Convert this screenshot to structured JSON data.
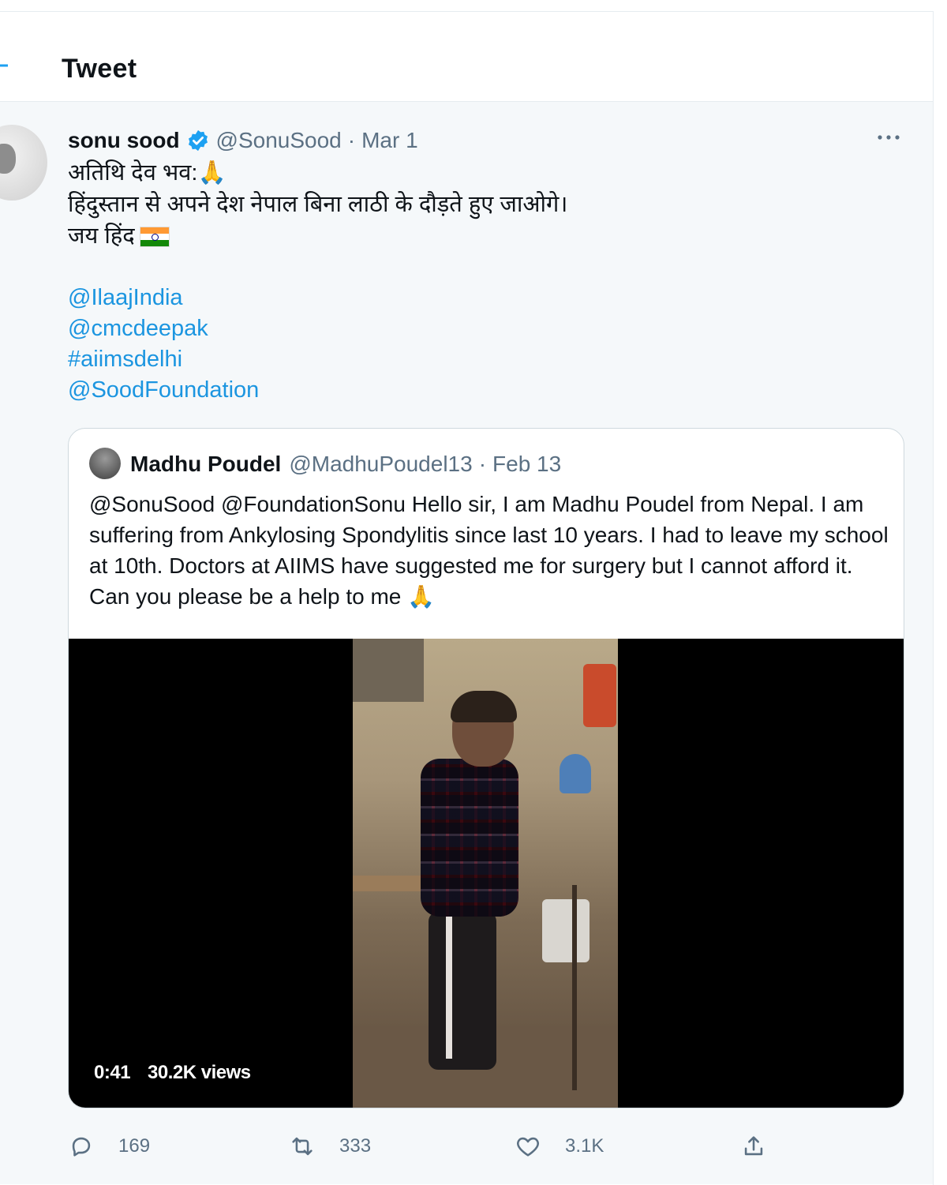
{
  "header": {
    "title": "Tweet"
  },
  "tweet": {
    "author_name": "sonu sood",
    "handle": "@SonuSood",
    "separator": "·",
    "date": "Mar 1",
    "text_lines": [
      "अतिथि देव भव:",
      "हिंदुस्तान से अपने देश नेपाल बिना लाठी के दौड़ते हुए जाओगे।",
      "जय हिंद"
    ],
    "hands_emoji": "🙏",
    "mentions": [
      "@IlaajIndia",
      "@cmcdeepak",
      "#aiimsdelhi",
      "@SoodFoundation"
    ]
  },
  "quote": {
    "author_name": "Madhu Poudel",
    "handle": "@MadhuPoudel13",
    "separator": "·",
    "date": "Feb 13",
    "text": "@SonuSood @FoundationSonu  Hello sir, I am Madhu Poudel from Nepal. I am suffering from Ankylosing Spondylitis since last 10 years. I had to leave my school at 10th. Doctors at AIIMS have suggested me for surgery but I cannot afford it. Can you please be a help to me ",
    "hands_emoji": "🙏",
    "video": {
      "duration": "0:41",
      "views": "30.2K views"
    }
  },
  "actions": {
    "replies": "169",
    "retweets": "333",
    "likes": "3.1K"
  },
  "colors": {
    "link": "#1b95e0",
    "verified": "#1da1f2",
    "secondary_text": "#5b7083",
    "border": "#cfd9de"
  }
}
